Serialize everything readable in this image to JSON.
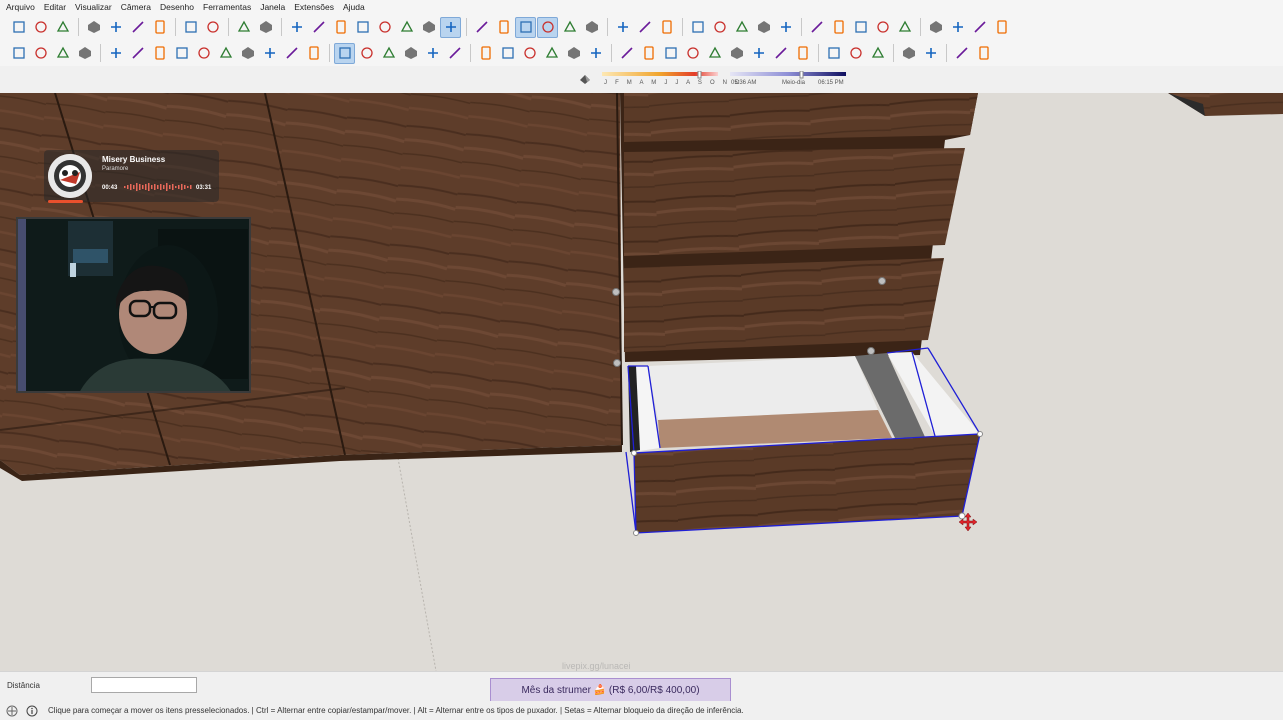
{
  "menu": [
    "Arquivo",
    "Editar",
    "Visualizar",
    "Câmera",
    "Desenho",
    "Ferramentas",
    "Janela",
    "Extensões",
    "Ajuda"
  ],
  "toolbar_row1_icons": [
    "new-icon",
    "open-icon",
    "save-icon",
    "cut-icon",
    "copy-icon",
    "paste-icon",
    "erase-icon",
    "undo-icon",
    "redo-icon",
    "print-icon",
    "model-info-icon",
    "iso-view-icon",
    "top-view-icon",
    "front-view-icon",
    "right-view-icon",
    "back-view-icon",
    "left-view-icon",
    "bottom-view-icon",
    "xray-icon",
    "back-edges-icon",
    "wireframe-icon",
    "hidden-line-icon",
    "shaded-icon",
    "shaded-textures-icon",
    "monochrome-icon",
    "section-plane-icon",
    "section-display-icon",
    "section-cut-icon",
    "warehouse-icon",
    "extension-warehouse-icon",
    "share-icon",
    "layout-icon",
    "sandbox-icon",
    "solid-tools-icon",
    "circle-plus-icon",
    "ruby-icon",
    "checker-icon",
    "cloud-icon",
    "gear-icon",
    "info-icon",
    "cart-icon",
    "account-icon"
  ],
  "toolbar_row2_icons": [
    "select-icon",
    "component-icon",
    "paint-bucket-icon",
    "eraser-icon",
    "line-icon",
    "freehand-icon",
    "rectangle-icon",
    "rotated-rectangle-icon",
    "circle-icon",
    "polygon-icon",
    "arc-icon",
    "two-point-arc-icon",
    "three-point-arc-icon",
    "pie-icon",
    "move-icon",
    "push-pull-icon",
    "rotate-icon",
    "follow-me-icon",
    "scale-icon",
    "offset-icon",
    "tape-measure-icon",
    "dimension-icon",
    "protractor-icon",
    "text-icon",
    "axes-icon",
    "3d-text-icon",
    "orbit-icon",
    "pan-icon",
    "zoom-icon",
    "zoom-window-icon",
    "zoom-extents-icon",
    "previous-view-icon",
    "position-camera-icon",
    "look-around-icon",
    "walk-icon",
    "box-icon",
    "cube-icon",
    "cube-alt-icon",
    "flip-icon",
    "soften-icon",
    "outliner-icon",
    "grid-icon"
  ],
  "shadow": {
    "months": "J F M A M J J A S O N D",
    "time_start": "05:36 AM",
    "time_mid": "Meio-dia",
    "time_end": "06:15 PM"
  },
  "music": {
    "song": "Misery Business",
    "artist": "Paramore",
    "current": "00:43",
    "duration": "03:31"
  },
  "status": {
    "measurement_label": "Distância",
    "measurement_value": "",
    "hint": "Clique para começar a mover os itens presselecionados. | Ctrl = Alternar entre copiar/estampar/mover. | Alt = Alternar entre os tipos de puxador. | Setas = Alternar bloqueio da direção de inferência.",
    "donation": "Mês da strumer 🍰 (R$ 6,00/R$ 400,00)",
    "watermark": "livepix.gg/lunacei"
  },
  "colors": {
    "wood": "#5a3a28",
    "wood_dark": "#3c2418",
    "selection": "#1f1fd6",
    "background": "#dedbd6"
  }
}
